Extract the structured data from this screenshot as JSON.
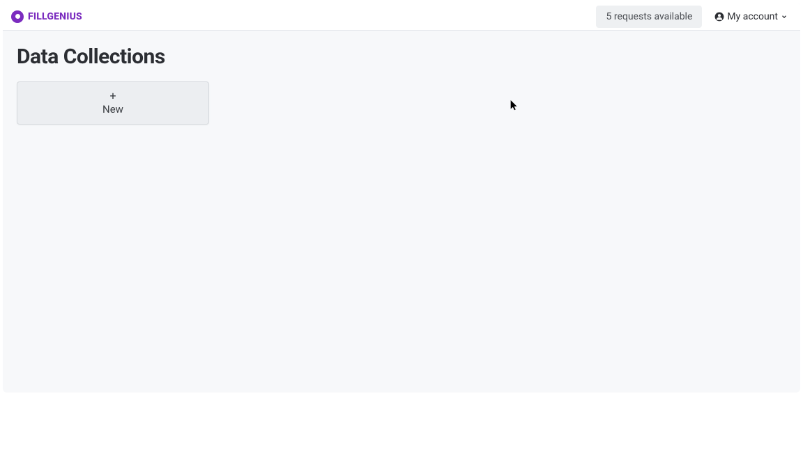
{
  "brand": {
    "prefix": "FILL",
    "suffix": "GENIUS"
  },
  "header": {
    "requests_badge": "5 requests available",
    "account_label": "My account"
  },
  "main": {
    "title": "Data Collections",
    "new_card": {
      "plus": "+",
      "label": "New"
    }
  }
}
